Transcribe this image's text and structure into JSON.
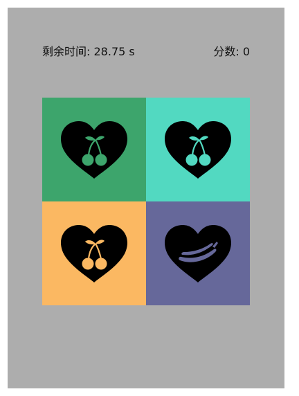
{
  "hud": {
    "time_label": "剩余时间:",
    "time_value": "28.75 s",
    "score_label": "分数:",
    "score_value": "0"
  },
  "tiles": [
    {
      "name": "tile-1",
      "bg": "#3da56c",
      "fruit": "cherry",
      "icon": "heart-cherry-icon"
    },
    {
      "name": "tile-2",
      "bg": "#52d9c1",
      "fruit": "cherry",
      "icon": "heart-cherry-icon"
    },
    {
      "name": "tile-3",
      "bg": "#fbb862",
      "fruit": "cherry",
      "icon": "heart-cherry-icon"
    },
    {
      "name": "tile-4",
      "bg": "#66689a",
      "fruit": "banana",
      "icon": "heart-banana-icon"
    }
  ],
  "colors": {
    "panel": "#adadad",
    "heart": "#000000"
  }
}
